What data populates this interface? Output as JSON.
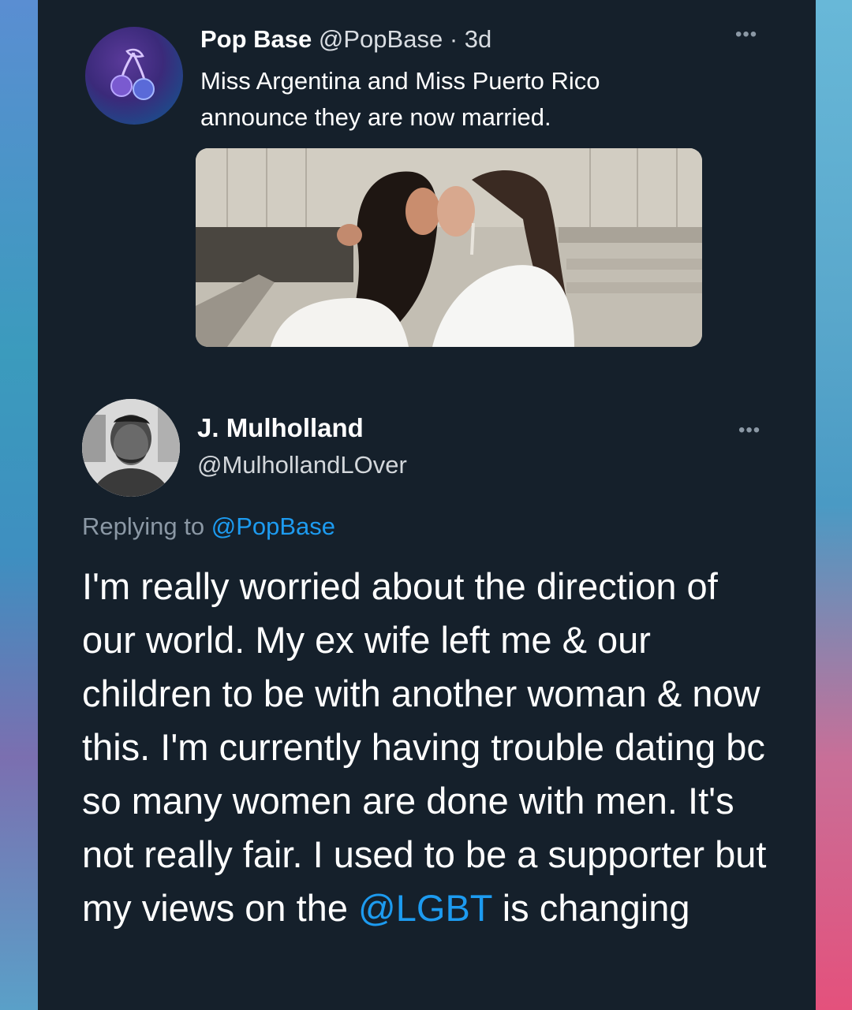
{
  "tweet": {
    "author_name": "Pop Base",
    "author_handle": "@PopBase",
    "separator": "·",
    "time": "3d",
    "text": "Miss Argentina and Miss Puerto Rico announce they are now married.",
    "more_icon": "more-horizontal-icon",
    "avatar_icon": "cherry-icon",
    "avatar_color": "#3b2a7a",
    "media_alt": "photo"
  },
  "reply": {
    "author_name": "J. Mulholland",
    "author_handle": "@MulhollandLOver",
    "replying_prefix": "Replying to",
    "replying_to": "@PopBase",
    "text_before_link": "I'm really worried about the direction of our world. My ex wife left me & our children to be with another woman & now this. I'm currently having trouble dating bc so many women are done with men. It's not really fair. I used to be a supporter but my views on the",
    "mention": "@LGBT",
    "text_after_link": "is changing",
    "more_icon": "more-horizontal-icon"
  },
  "colors": {
    "background": "#15202b",
    "link": "#1d9bf0",
    "secondary_text": "#8b98a5",
    "primary_text": "#ffffff"
  }
}
